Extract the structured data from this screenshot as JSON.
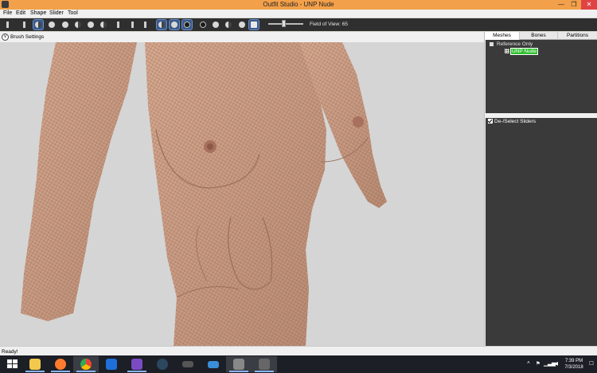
{
  "window": {
    "title": "Outfit Studio - UNP Nude",
    "minimize_glyph": "—",
    "maximize_glyph": "❐",
    "close_glyph": "✕"
  },
  "menu": [
    "File",
    "Edit",
    "Shape",
    "Slider",
    "Tool"
  ],
  "toolbar": {
    "fov_label": "Field of View: 65"
  },
  "brush": {
    "chevron": "v",
    "label": "Brush Settings"
  },
  "right_panel": {
    "tabs": [
      "Meshes",
      "Bones",
      "Partitions"
    ],
    "tree": {
      "root": "Reference Only",
      "mesh": "UNP Nude"
    },
    "sliders_header": "De-/Select Sliders"
  },
  "status": {
    "text": "Ready!"
  },
  "taskbar": {
    "apps": [
      {
        "name": "file-explorer-icon",
        "color": "#f2c94c"
      },
      {
        "name": "firefox-icon",
        "color": "#ff7b2d"
      },
      {
        "name": "chrome-icon",
        "color": "#34a853"
      },
      {
        "name": "shield-app-icon",
        "color": "#1e6fd9"
      },
      {
        "name": "visual-studio-icon",
        "color": "#7b4bc4"
      },
      {
        "name": "steam-icon",
        "color": "#2a475e"
      },
      {
        "name": "gamepad-icon",
        "color": "#555555"
      },
      {
        "name": "vr-headset-icon",
        "color": "#3a8fd8"
      },
      {
        "name": "outfit-studio-icon",
        "color": "#888888"
      },
      {
        "name": "bodyslide-icon",
        "color": "#666666"
      }
    ],
    "tray": {
      "chevron": "˄",
      "flag": "⚑",
      "network": "▁▃▅",
      "volume": "◀",
      "notifications": "☐"
    },
    "clock": {
      "time": "7:39 PM",
      "date": "7/3/2018"
    }
  },
  "colors": {
    "titlebar": "#f2a04a",
    "toolbar": "#2f2f2f",
    "mesh_highlight": "#2ec02e",
    "viewport": "#d5d5d5"
  }
}
